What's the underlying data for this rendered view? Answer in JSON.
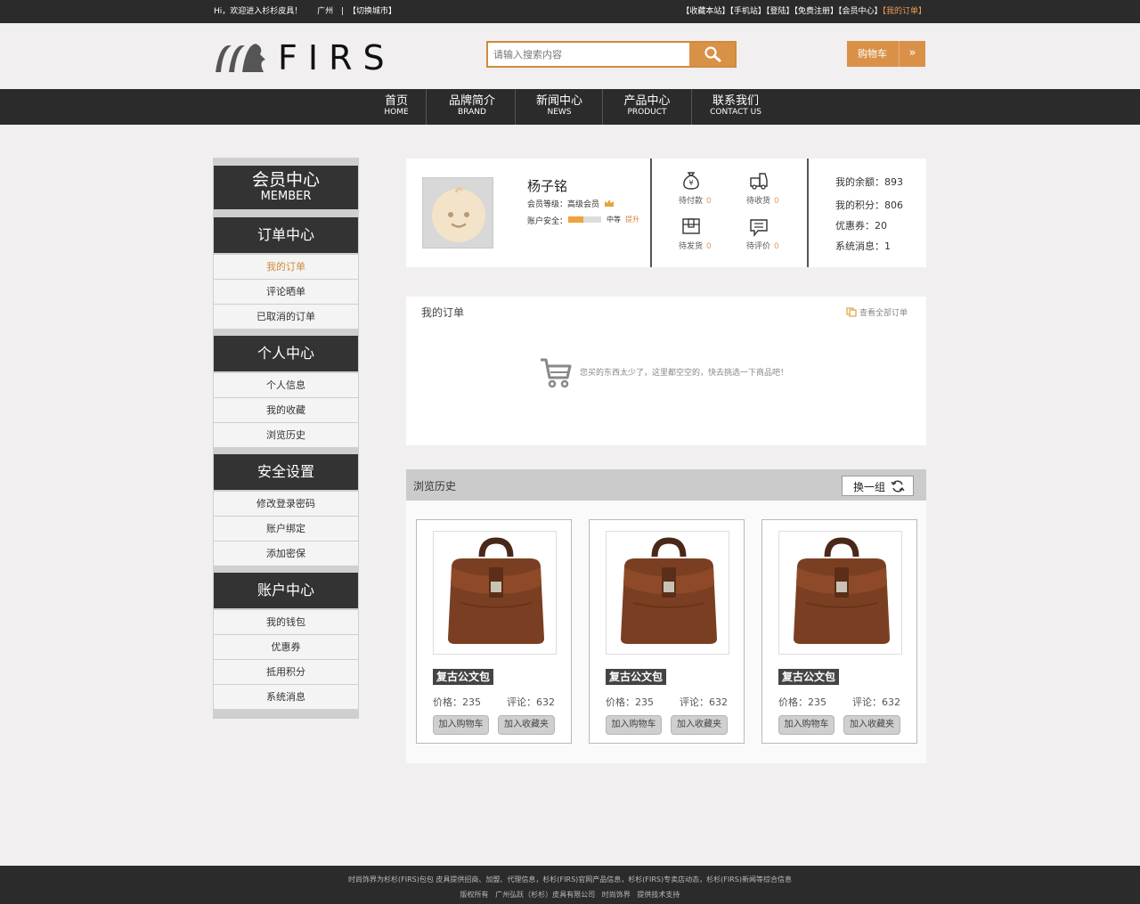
{
  "topbar": {
    "welcome": "Hi，欢迎进入杉杉皮具！",
    "city": "广州",
    "switch_city": "【切换城市】",
    "links": [
      "【收藏本站】",
      "【手机站】",
      "【登陆】",
      "【免费注册】",
      "【会员中心】"
    ],
    "my_orders_link": "【我的订单】"
  },
  "header": {
    "logo_text": "FIRS",
    "search_placeholder": "请输入搜索内容",
    "cart_label": "购物车",
    "cart_arrow": "»"
  },
  "nav": [
    {
      "cn": "首页",
      "en": "HOME"
    },
    {
      "cn": "品牌简介",
      "en": "BRAND"
    },
    {
      "cn": "新闻中心",
      "en": "NEWS"
    },
    {
      "cn": "产品中心",
      "en": "PRODUCT"
    },
    {
      "cn": "联系我们",
      "en": "CONTACT US"
    }
  ],
  "sidebar": {
    "member_title": "会员中心",
    "member_en": "MEMBER",
    "sections": [
      {
        "title": "订单中心",
        "items": [
          "我的订单",
          "评论晒单",
          "已取消的订单"
        ]
      },
      {
        "title": "个人中心",
        "items": [
          "个人信息",
          "我的收藏",
          "浏览历史"
        ]
      },
      {
        "title": "安全设置",
        "items": [
          "修改登录密码",
          "账户绑定",
          "添加密保"
        ]
      },
      {
        "title": "账户中心",
        "items": [
          "我的钱包",
          "优惠券",
          "抵用积分",
          "系统消息"
        ]
      }
    ]
  },
  "profile": {
    "name": "杨子铭",
    "level_label": "会员等级：",
    "level_value": "高级会员",
    "security_label": "账户安全：",
    "security_level": "中等",
    "security_fill": 0.45,
    "upgrade": "提升",
    "stats": [
      {
        "label": "待付款",
        "count": "0"
      },
      {
        "label": "待收货",
        "count": "0"
      },
      {
        "label": "待发货",
        "count": "0"
      },
      {
        "label": "待评价",
        "count": "0"
      }
    ],
    "account": [
      {
        "label": "我的余额：",
        "value": "893"
      },
      {
        "label": "我的积分：",
        "value": "806"
      },
      {
        "label": "优惠券：",
        "value": "20"
      },
      {
        "label": "系统消息：",
        "value": "1"
      }
    ]
  },
  "orders": {
    "title": "我的订单",
    "view_all": "查看全部订单",
    "empty_text": "您买的东西太少了，这里都空空的，快去挑选一下商品吧！"
  },
  "history": {
    "title": "浏览历史",
    "refresh_label": "换一组",
    "products": [
      {
        "name": "复古公文包",
        "price": "价格：235",
        "reviews": "评论：632",
        "add_cart": "加入购物车",
        "add_fav": "加入收藏夹"
      },
      {
        "name": "复古公文包",
        "price": "价格：235",
        "reviews": "评论：632",
        "add_cart": "加入购物车",
        "add_fav": "加入收藏夹"
      },
      {
        "name": "复古公文包",
        "price": "价格：235",
        "reviews": "评论：632",
        "add_cart": "加入购物车",
        "add_fav": "加入收藏夹"
      }
    ]
  },
  "footer": {
    "line1": "时尚饰界为杉杉(FIRS)包包 皮具提供招商、加盟、代理信息，杉杉(FIRS)官网产品信息，杉杉(FIRS)专卖店动态，杉杉(FIRS)新闻等综合信息",
    "line2": "版权所有   广州弘跃（杉杉）皮具有限公司   时尚饰界   提供技术支持"
  },
  "colors": {
    "accent": "#d99148",
    "dark": "#2b2b2b",
    "bg": "#f1efef"
  }
}
